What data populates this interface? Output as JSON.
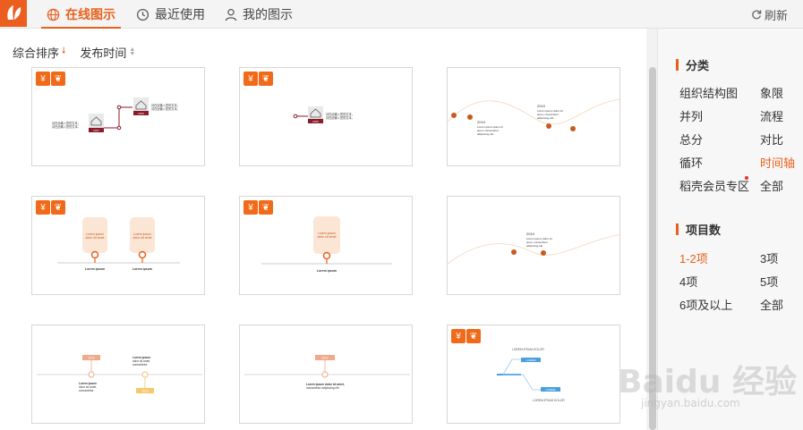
{
  "tabs": [
    {
      "label": "在线图示",
      "icon": "globe-icon",
      "active": true
    },
    {
      "label": "最近使用",
      "icon": "clock-icon",
      "active": false
    },
    {
      "label": "我的图示",
      "icon": "user-icon",
      "active": false
    }
  ],
  "refresh_label": "刷新",
  "sort": {
    "comprehensive": "综合排序",
    "publish_time": "发布时间"
  },
  "badge": {
    "price_glyph": "¥",
    "leaf_glyph": "❦"
  },
  "side": {
    "category_title": "分类",
    "categories": [
      "组织结构图",
      "象限",
      "并列",
      "流程",
      "总分",
      "对比",
      "循环",
      "时间轴",
      "稻壳会员专区",
      "全部"
    ],
    "active_category": "时间轴",
    "count_title": "项目数",
    "counts": [
      "1-2项",
      "3项",
      "4项",
      "5项",
      "6项及以上",
      "全部"
    ],
    "active_count": "1-2项"
  },
  "cards": {
    "c1": {
      "t1": "请在此输入您的文本，\n请在此输入您的文本。",
      "y1": "2017",
      "t2": "请在此输入您的文本，\n请在此输入您的文本。",
      "y2": "2016"
    },
    "c2": {
      "t1": "请在此输入您的文本，\n请在此输入您的文本。",
      "y1": "2016"
    },
    "c3": {
      "y1": "2019",
      "t1": "Lorem ipsum dolor sit\namet, consectetur\nadipiscing elit.",
      "y2": "2019",
      "t2": "Lorem ipsum dolor sit\namet, consectetur\nadipiscing elit."
    },
    "c4": {
      "l1": "Lorem ipsum\ndolor sit amet",
      "l2": "Lorem ipsum\ndolor sit amet",
      "b1": "Lorem ipsum",
      "b2": "Lorem ipsum"
    },
    "c5": {
      "l1": "Lorem ipsum\ndolor sit amet",
      "b1": "Lorem ipsum"
    },
    "c6": {
      "y1": "2019",
      "t1": "Lorem ipsum dolor sit\namet, consectetur\nadipiscing elit."
    },
    "c7": {
      "y1": "2019",
      "y2": "2019",
      "t1": "Lorem ipsum\ndolor sit amet,\nconsectetur",
      "t2": "Lorem ipsum\ndolor sit amet,\nconsectetur"
    },
    "c8": {
      "y1": "2019",
      "t1": "Lorem ipsum dolor sit amet,\nconsectetur adipiscing elit."
    },
    "c9": {
      "h1": "LOREM IPSUM DOLOR",
      "p1": "LOREM",
      "p2": "LOREM",
      "h2": "LOREM IPSUM DOLOR"
    }
  },
  "watermark": {
    "main": "Baidu 经验",
    "sub": "jingyan.baidu.com"
  },
  "colors": {
    "accent": "#e8611c",
    "timeline_dark": "#8b1a2b",
    "orange_mark": "#c85a1e"
  }
}
